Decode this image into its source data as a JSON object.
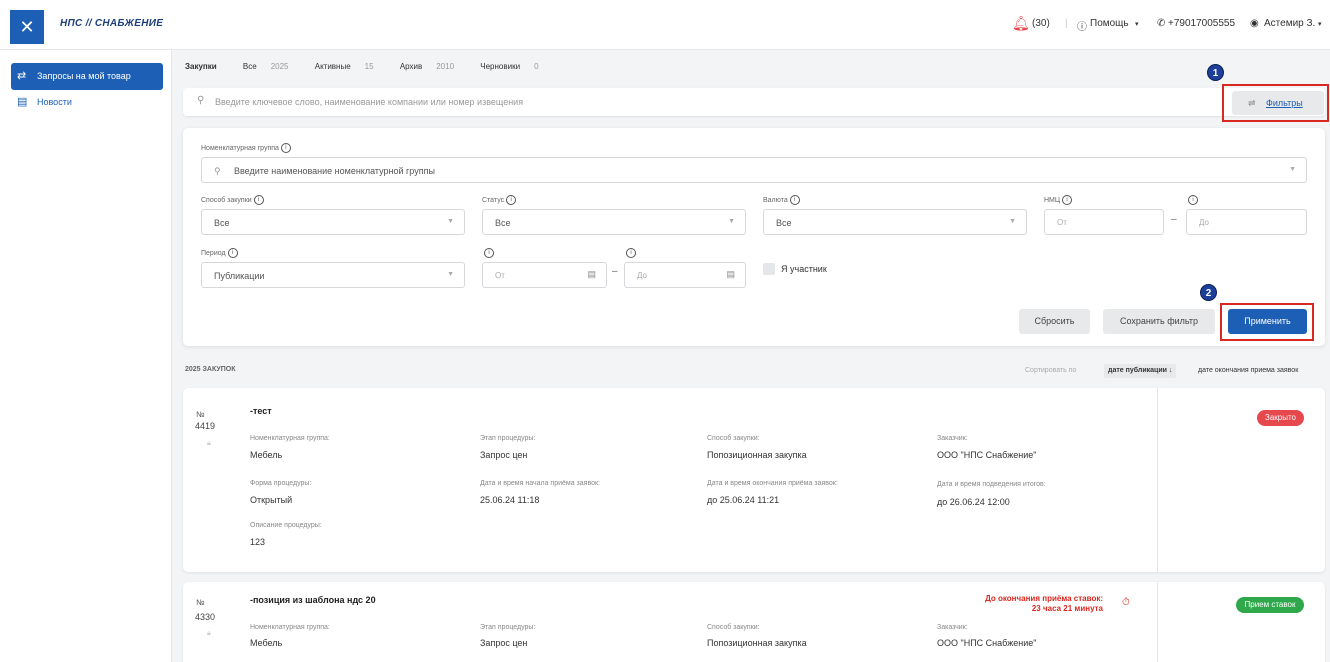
{
  "header": {
    "logo": "НПС // СНАБЖЕНИЕ",
    "notif_count": "(30)",
    "help": "Помощь",
    "phone": "+79017005555",
    "user": "Астемир З."
  },
  "sidebar": {
    "items": [
      {
        "label": "Запросы на мой товар"
      },
      {
        "label": "Новости"
      }
    ]
  },
  "tabs": [
    {
      "label": "Закупки",
      "count": ""
    },
    {
      "label": "Все",
      "count": "2025"
    },
    {
      "label": "Активные",
      "count": "15"
    },
    {
      "label": "Архив",
      "count": "2010"
    },
    {
      "label": "Черновики",
      "count": "0"
    }
  ],
  "search": {
    "placeholder": "Введите ключевое слово, наименование компании или номер извещения",
    "filters_label": "Фильтры"
  },
  "annotations": [
    "1",
    "2"
  ],
  "filters": {
    "nomenclature_label": "Номенклатурная группа",
    "nomenclature_placeholder": "Введите наименование номенклатурной группы",
    "method_label": "Способ закупки",
    "method_value": "Все",
    "status_label": "Статус",
    "status_value": "Все",
    "currency_label": "Валюта",
    "currency_value": "Все",
    "nmc_label": "НМЦ",
    "from_ph": "От",
    "to_ph": "До",
    "period_label": "Период",
    "period_value": "Публикации",
    "participant_label": "Я участник",
    "reset": "Сбросить",
    "save": "Сохранить фильтр",
    "apply": "Применить"
  },
  "list": {
    "count_title": "2025 ЗАКУПОК",
    "sort_label": "Сортировать по",
    "sort_pub": "дате публикации ↓",
    "sort_end": "дате окончания приема заявок"
  },
  "cards": [
    {
      "num_symbol": "№",
      "num": "4419",
      "title": "-тест",
      "status": "Закрыто",
      "status_color": "#e5484d",
      "nomenclature_label": "Номенклатурная группа:",
      "nomenclature": "Мебель",
      "stage_label": "Этап процедуры:",
      "stage": "Запрос цен",
      "method_label": "Способ закупки:",
      "method": "Попозиционная закупка",
      "customer_label": "Заказчик:",
      "customer": "ООО \"НПС Снабжение\"",
      "form_label": "Форма процедуры:",
      "form": "Открытый",
      "start_label": "Дата и время начала приёма заявок:",
      "start": "25.06.24 11:18",
      "end_label": "Дата и время окончания приёма заявок:",
      "end": "до 25.06.24 11:21",
      "result_label": "Дата и время подведения итогов:",
      "result": "до 26.06.24 12:00",
      "desc_label": "Описание процедуры:",
      "desc": "123"
    },
    {
      "num_symbol": "№",
      "num": "4330",
      "title": "-позиция из шаблона ндс 20",
      "status": "Прием ставок",
      "status_color": "#2ea84a",
      "deadline_line1": "До окончания приёма ставок:",
      "deadline_line2": "23 часа 21 минута",
      "nomenclature_label": "Номенклатурная группа:",
      "nomenclature": "Мебель",
      "stage_label": "Этап процедуры:",
      "stage": "Запрос цен",
      "method_label": "Способ закупки:",
      "method": "Попозиционная закупка",
      "customer_label": "Заказчик:",
      "customer": "ООО \"НПС Снабжение\""
    }
  ]
}
